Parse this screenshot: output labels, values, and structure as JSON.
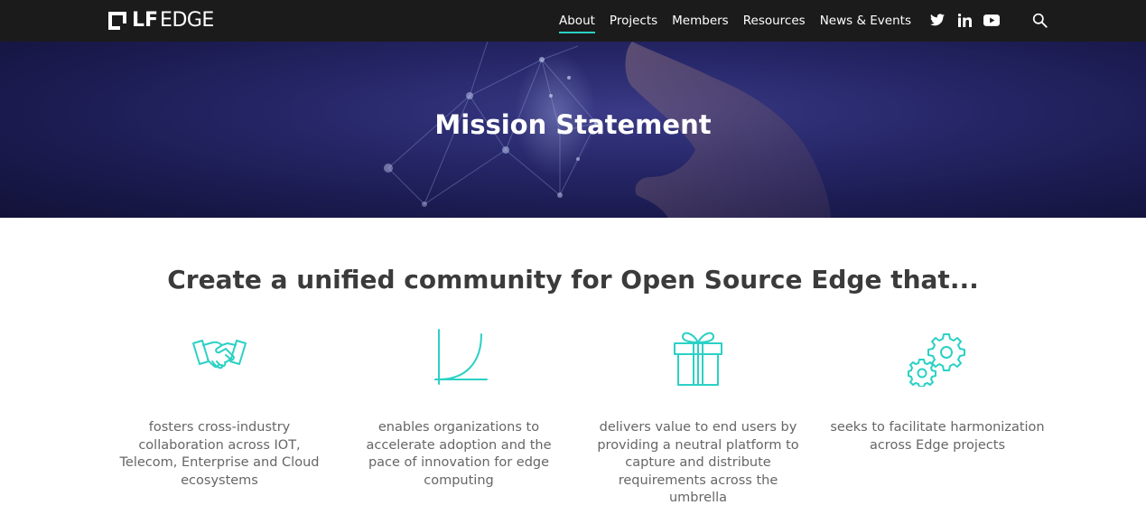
{
  "header": {
    "logo": {
      "lf": "LF",
      "edge": "EDGE"
    },
    "nav": [
      {
        "label": "About",
        "active": true
      },
      {
        "label": "Projects",
        "active": false
      },
      {
        "label": "Members",
        "active": false
      },
      {
        "label": "Resources",
        "active": false
      },
      {
        "label": "News & Events",
        "active": false
      }
    ],
    "social_icons": [
      "twitter-icon",
      "linkedin-icon",
      "youtube-icon"
    ],
    "search_icon": "search-icon"
  },
  "hero": {
    "title": "Mission Statement"
  },
  "main": {
    "headline": "Create a unified community for Open Source Edge that...",
    "features": [
      {
        "icon": "handshake-icon",
        "text": "fosters cross-industry collaboration across IOT, Telecom, Enterprise and Cloud ecosystems"
      },
      {
        "icon": "growth-curve-icon",
        "text": "enables organizations to accelerate adoption and the pace of innovation for edge computing"
      },
      {
        "icon": "gift-icon",
        "text": "delivers value to end users by providing a neutral platform to capture and distribute requirements across the umbrella"
      },
      {
        "icon": "gears-icon",
        "text": "seeks to facilitate harmonization across Edge projects"
      }
    ]
  },
  "colors": {
    "accent": "#2bd1c5",
    "topbar": "#1b1b1b",
    "hero": "#27276a"
  }
}
